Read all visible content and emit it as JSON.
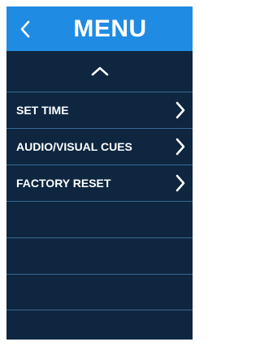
{
  "header": {
    "title": "MENU",
    "back_icon": "chevron-left-icon",
    "background_color": "#1f8be2"
  },
  "scroll_up_icon": "chevron-up-icon",
  "menu": {
    "background_color": "#0e2640",
    "divider_color": "#3a6a94",
    "items": [
      {
        "label": "SET TIME",
        "icon": "chevron-right-icon"
      },
      {
        "label": "AUDIO/VISUAL CUES",
        "icon": "chevron-right-icon"
      },
      {
        "label": "FACTORY RESET",
        "icon": "chevron-right-icon"
      },
      {
        "label": ""
      },
      {
        "label": ""
      },
      {
        "label": ""
      }
    ]
  }
}
